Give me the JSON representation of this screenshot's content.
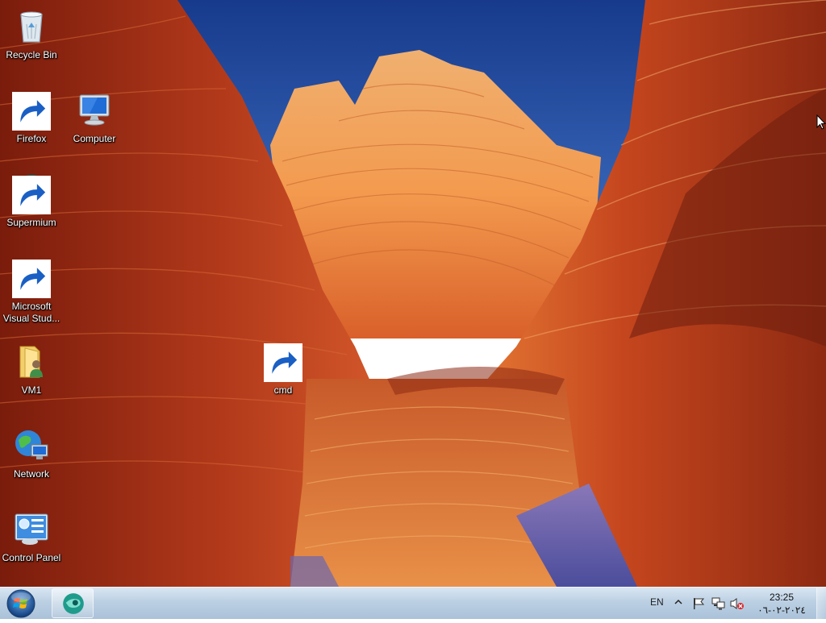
{
  "desktop": {
    "icons": [
      {
        "label": "Recycle Bin",
        "icon": "recycle-bin-icon",
        "shortcut": false
      },
      {
        "label": "Firefox",
        "icon": "firefox-icon",
        "shortcut": true
      },
      {
        "label": "Computer",
        "icon": "computer-icon",
        "shortcut": false
      },
      {
        "label": "Supermium",
        "icon": "supermium-icon",
        "shortcut": true
      },
      {
        "label": "Microsoft\nVisual Stud...",
        "icon": "visual-studio-icon",
        "shortcut": true
      },
      {
        "label": "VM1",
        "icon": "user-folder-icon",
        "shortcut": false
      },
      {
        "label": "cmd",
        "icon": "cmd-icon",
        "shortcut": true
      },
      {
        "label": "Network",
        "icon": "network-icon",
        "shortcut": false
      },
      {
        "label": "Control Panel",
        "icon": "control-panel-icon",
        "shortcut": false
      }
    ]
  },
  "taskbar": {
    "pinned": [
      {
        "name": "Supermium",
        "icon": "supermium-icon"
      }
    ],
    "language": "EN",
    "tray_icons": [
      "show-hidden-icons",
      "action-center-flag-icon",
      "network-icon",
      "volume-muted-icon"
    ],
    "clock": {
      "time": "23:25",
      "date": "٢٠٢٤-٠٢-٠٦"
    }
  },
  "colors": {
    "taskbar_top": "#d9e6f2",
    "taskbar_bottom": "#a9c1d9",
    "sky": "#1d3f8f",
    "rock_orange": "#e8752a",
    "rock_red": "#9c2f14"
  }
}
